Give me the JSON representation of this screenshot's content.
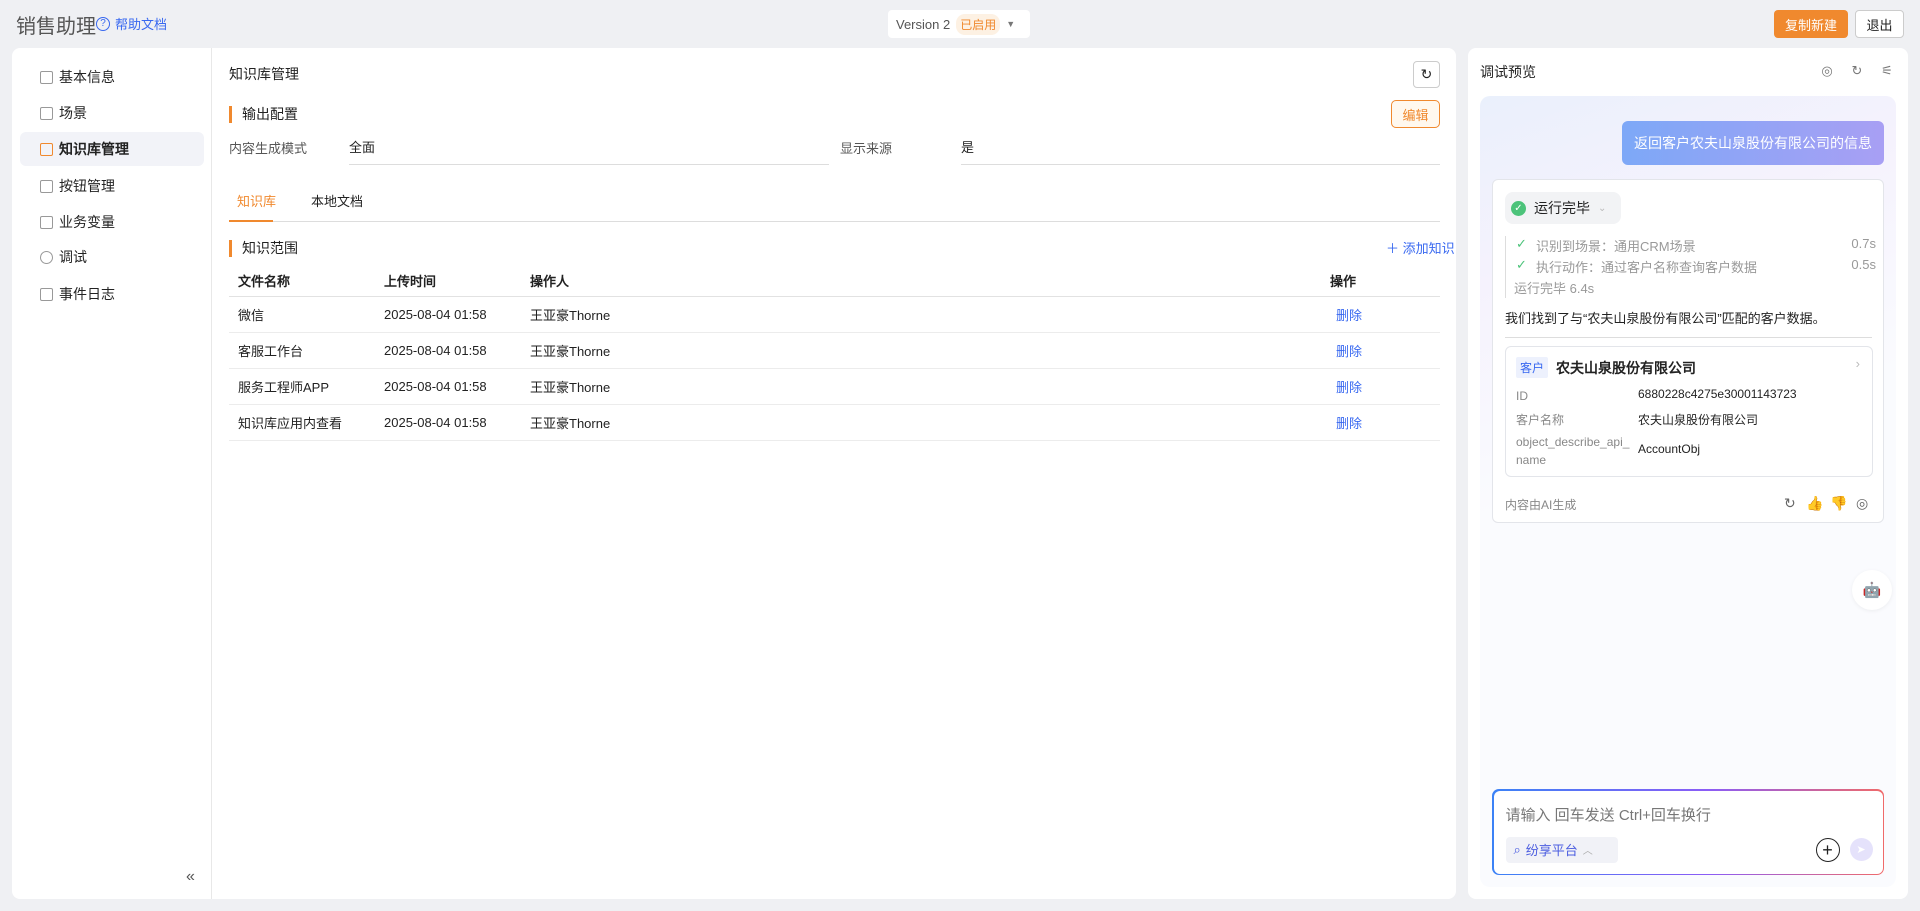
{
  "header": {
    "app_title": "销售助理",
    "help": "帮助文档",
    "version": "Version 2",
    "version_status": "已启用",
    "copy_new": "复制新建",
    "exit": "退出"
  },
  "sidebar": {
    "items": [
      {
        "label": "基本信息"
      },
      {
        "label": "场景"
      },
      {
        "label": "知识库管理",
        "active": true
      },
      {
        "label": "按钮管理"
      },
      {
        "label": "业务变量"
      },
      {
        "label": "调试"
      },
      {
        "label": "事件日志"
      }
    ],
    "collapse": "«"
  },
  "main": {
    "title": "知识库管理",
    "output_config": "输出配置",
    "edit": "编辑",
    "mode_label": "内容生成模式",
    "mode_value": "全面",
    "source_label": "显示来源",
    "source_value": "是",
    "tabs": [
      "知识库",
      "本地文档"
    ],
    "scope": "知识范围",
    "add": "添加知识",
    "columns": [
      "文件名称",
      "上传时间",
      "操作人",
      "操作"
    ],
    "rows": [
      {
        "name": "微信",
        "time": "2025-08-04 01:58",
        "op": "王亚豪Thorne",
        "action": "删除"
      },
      {
        "name": "客服工作台",
        "time": "2025-08-04 01:58",
        "op": "王亚豪Thorne",
        "action": "删除"
      },
      {
        "name": "服务工程师APP",
        "time": "2025-08-04 01:58",
        "op": "王亚豪Thorne",
        "action": "删除"
      },
      {
        "name": "知识库应用内查看",
        "time": "2025-08-04 01:58",
        "op": "王亚豪Thorne",
        "action": "删除"
      }
    ]
  },
  "preview": {
    "title": "调试预览",
    "user_msg": "返回客户农夫山泉股份有限公司的信息",
    "status": "运行完毕",
    "steps": [
      {
        "text": "识别到场景：通用CRM场景",
        "time": "0.7s"
      },
      {
        "text": "执行动作：通过客户名称查询客户数据",
        "time": "0.5s"
      }
    ],
    "total": "运行完毕 6.4s",
    "found": "我们找到了与“农夫山泉股份有限公司”匹配的客户数据。",
    "customer": {
      "tag": "客户",
      "name": "农夫山泉股份有限公司",
      "fields": [
        {
          "k": "ID",
          "v": "6880228c4275e30001143723"
        },
        {
          "k": "客户名称",
          "v": "农夫山泉股份有限公司"
        },
        {
          "k": "object_describe_api_name",
          "v": "AccountObj"
        }
      ]
    },
    "ai_note": "内容由AI生成",
    "input_placeholder": "请输入 回车发送 Ctrl+回车换行",
    "platform": "纷享平台"
  }
}
